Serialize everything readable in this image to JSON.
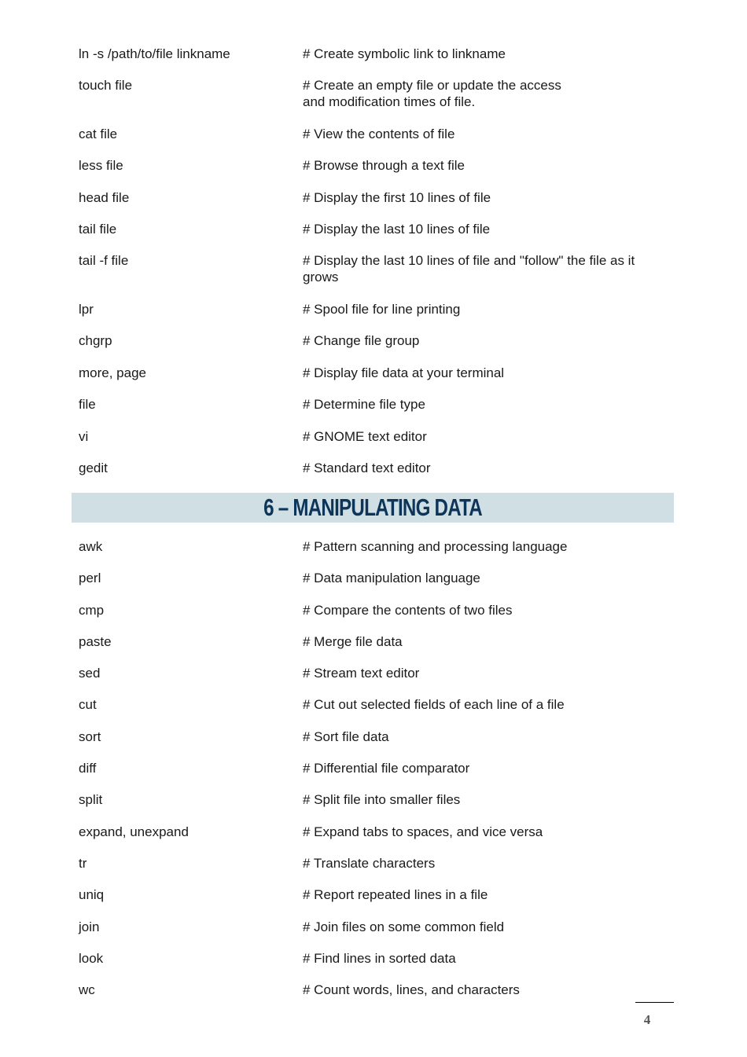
{
  "section_continued": {
    "rows": [
      {
        "command": "ln -s /path/to/file linkname",
        "description": "# Create symbolic link to linkname"
      },
      {
        "command": "touch file",
        "description": "# Create an empty file or update the access",
        "description2": "and modification times of file."
      },
      {
        "command": "cat file",
        "description": "# View the contents of file"
      },
      {
        "command": "less file",
        "description": "# Browse through a text file"
      },
      {
        "command": "head file",
        "description": "# Display the first 10 lines of file"
      },
      {
        "command": "tail file",
        "description": "# Display the last 10 lines of file"
      },
      {
        "command": "tail -f file",
        "description": "# Display the last 10 lines of file and \"follow\" the file as it",
        "description2": "grows"
      },
      {
        "command": "lpr",
        "description": "# Spool file for line printing"
      },
      {
        "command": "chgrp",
        "description": "# Change file group"
      },
      {
        "command": "more, page",
        "description": "# Display file data at your terminal"
      },
      {
        "command": "file",
        "description": "# Determine file type"
      },
      {
        "command": "vi",
        "description": "# GNOME text editor"
      },
      {
        "command": "gedit",
        "description": "# Standard text editor"
      }
    ]
  },
  "section6": {
    "heading": "6 – MANIPULATING DATA",
    "rows": [
      {
        "command": "awk",
        "description": "# Pattern scanning and processing language"
      },
      {
        "command": "perl",
        "description": "# Data manipulation language"
      },
      {
        "command": "cmp",
        "description": "# Compare the contents of two files"
      },
      {
        "command": "paste",
        "description": "# Merge file data"
      },
      {
        "command": "sed",
        "description": "# Stream text editor"
      },
      {
        "command": "cut",
        "description": "# Cut out selected fields of each line of a file"
      },
      {
        "command": "sort",
        "description": "# Sort file data"
      },
      {
        "command": "diff",
        "description": "# Differential file comparator"
      },
      {
        "command": "split",
        "description": "# Split file into smaller files"
      },
      {
        "command": "expand, unexpand",
        "description": "# Expand tabs to spaces, and vice versa"
      },
      {
        "command": "tr",
        "description": "# Translate characters"
      },
      {
        "command": "uniq",
        "description": "# Report repeated lines in a file"
      },
      {
        "command": "join",
        "description": "# Join files on some common field"
      },
      {
        "command": "look",
        "description": "# Find lines in sorted data"
      },
      {
        "command": "wc",
        "description": "# Count words, lines, and characters"
      }
    ]
  },
  "footer": {
    "page_number": "4"
  },
  "colors": {
    "banner_background": "#d0dfe4",
    "banner_text": "#0d3559"
  }
}
